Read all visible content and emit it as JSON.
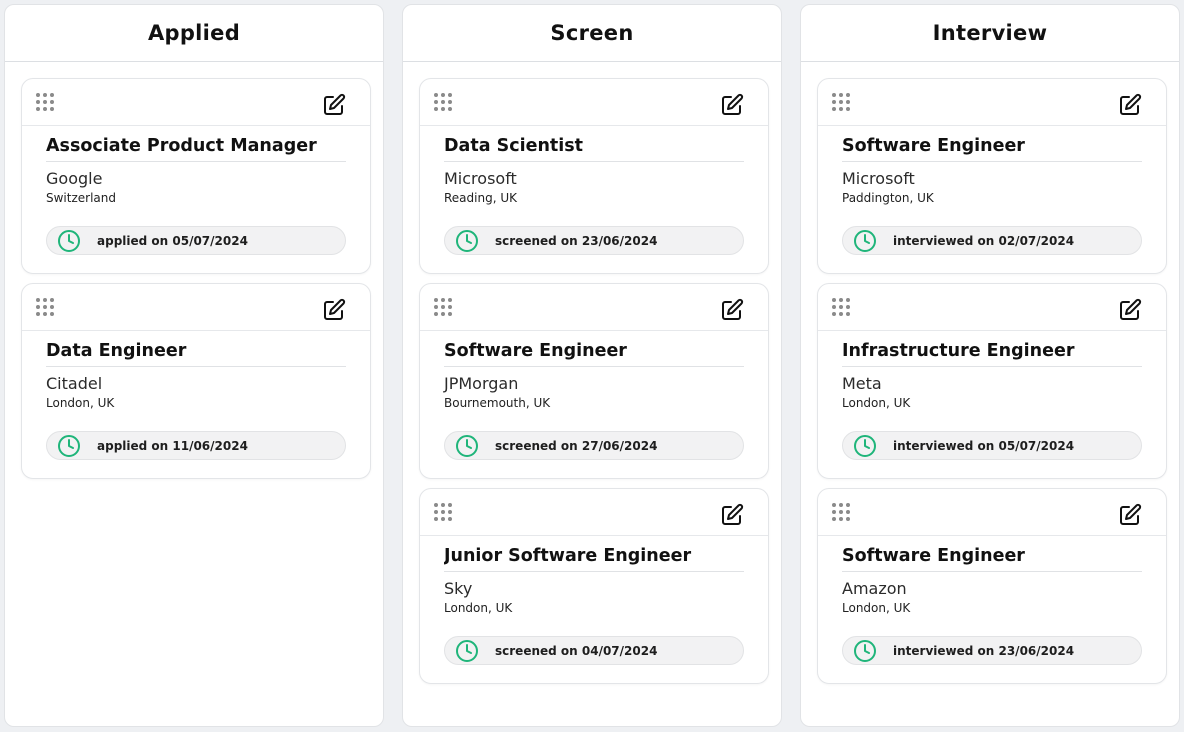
{
  "colors": {
    "accent_green": "#1fb57a",
    "icon_gray": "#8a8a8a"
  },
  "icons": {
    "drag": "drag-handle-icon",
    "edit": "edit-icon",
    "clock": "clock-icon"
  },
  "columns": [
    {
      "title": "Applied",
      "cards": [
        {
          "title": "Associate Product Manager",
          "company": "Google",
          "location": "Switzerland",
          "status": "applied on 05/07/2024"
        },
        {
          "title": "Data Engineer",
          "company": "Citadel",
          "location": "London, UK",
          "status": "applied on 11/06/2024"
        }
      ]
    },
    {
      "title": "Screen",
      "cards": [
        {
          "title": "Data Scientist",
          "company": "Microsoft",
          "location": "Reading, UK",
          "status": "screened on 23/06/2024"
        },
        {
          "title": "Software Engineer",
          "company": "JPMorgan",
          "location": "Bournemouth, UK",
          "status": "screened on 27/06/2024"
        },
        {
          "title": "Junior Software Engineer",
          "company": "Sky",
          "location": "London, UK",
          "status": "screened on 04/07/2024"
        }
      ]
    },
    {
      "title": "Interview",
      "cards": [
        {
          "title": "Software Engineer",
          "company": "Microsoft",
          "location": "Paddington, UK",
          "status": "interviewed on 02/07/2024"
        },
        {
          "title": "Infrastructure Engineer",
          "company": "Meta",
          "location": "London, UK",
          "status": "interviewed on 05/07/2024"
        },
        {
          "title": "Software Engineer",
          "company": "Amazon",
          "location": "London, UK",
          "status": "interviewed on 23/06/2024"
        }
      ]
    }
  ]
}
